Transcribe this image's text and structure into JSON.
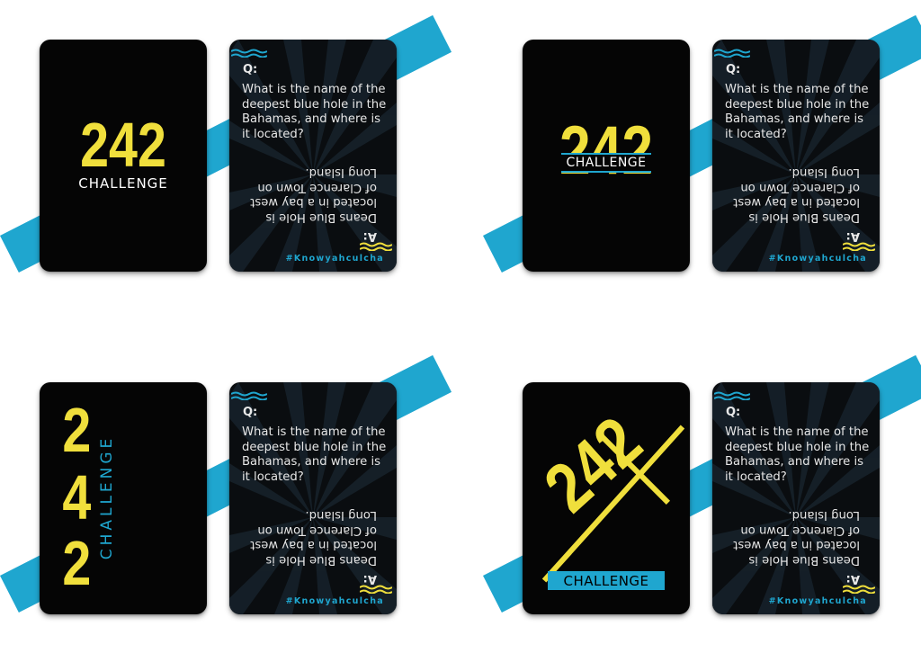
{
  "accent_color": "#1fa6cf",
  "logo_color": "#f0df3c",
  "logo": {
    "number": "242",
    "digits": [
      "2",
      "4",
      "2"
    ],
    "word": "CHALLENGE"
  },
  "question_card": {
    "q_label": "Q:",
    "question": "What is the name of the deepest blue hole in the Bahamas, and where is it located?",
    "a_label": "A:",
    "answer": "Deans Blue Hole is located in a bay west of Clarence Town on Long Island.",
    "hashtag": "#Knowyahculcha"
  }
}
